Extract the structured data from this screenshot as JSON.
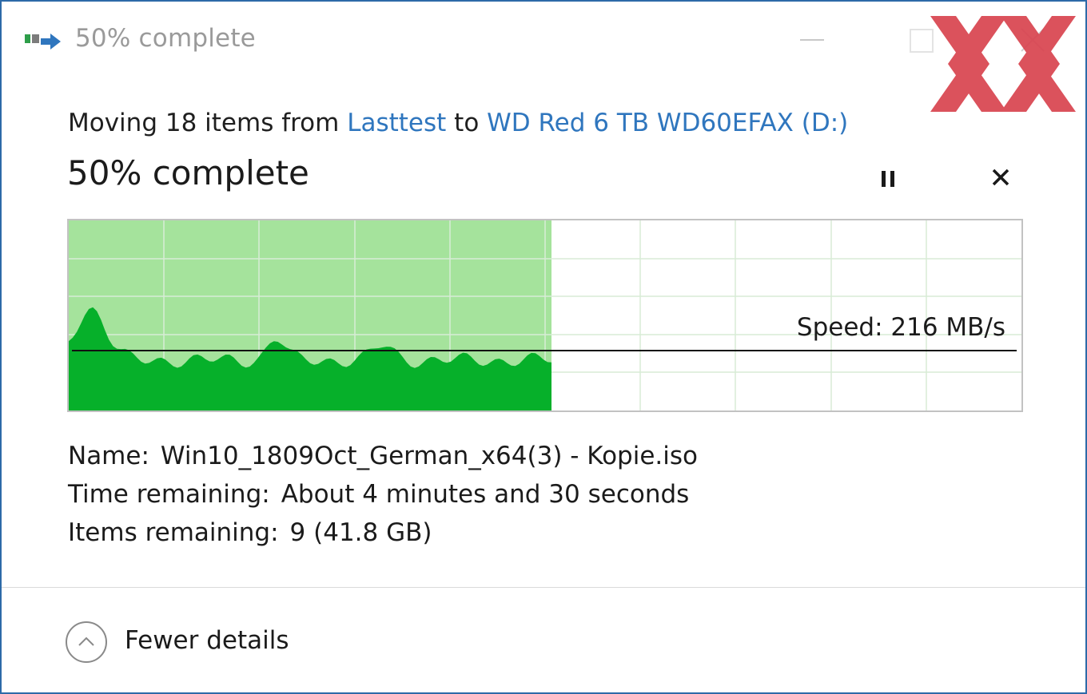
{
  "window": {
    "title": "50% complete",
    "icon": "file-move-icon"
  },
  "watermark": {
    "text": "XX",
    "color": "#d9444f"
  },
  "copy": {
    "moving_prefix": "Moving 18 items from ",
    "source": "Lasttest",
    "to_word": " to ",
    "destination": "WD Red 6 TB WD60EFAX (D:)",
    "status": "50% complete",
    "progress_fraction": 0.5,
    "speed_label": "Speed: 216 MB/s"
  },
  "details": {
    "name_label": "Name:",
    "name_value": "Win10_1809Oct_German_x64(3) - Kopie.iso",
    "time_label": "Time remaining:",
    "time_value": "About 4 minutes and 30 seconds",
    "items_label": "Items remaining:",
    "items_value": "9 (41.8 GB)"
  },
  "footer": {
    "toggle_label": "Fewer details"
  },
  "colors": {
    "accent_link": "#2f76be",
    "progress_fill": "#a5e39c",
    "speed_fill": "#06b02a",
    "frame": "#2d6aa8"
  }
}
